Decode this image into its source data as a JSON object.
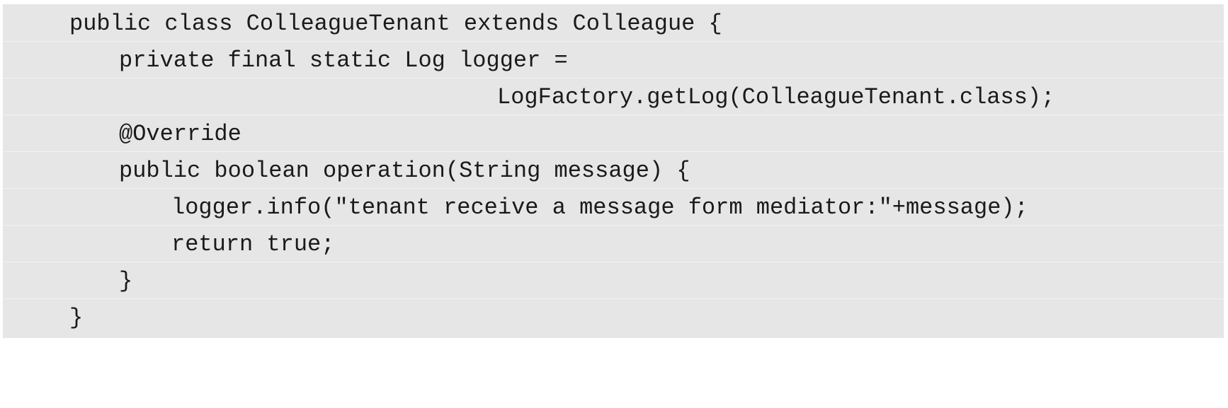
{
  "code": {
    "lines": [
      "public class ColleagueTenant extends Colleague {",
      "private final static Log logger =",
      "LogFactory.getLog(ColleagueTenant.class);",
      "@Override",
      "public boolean operation(String message) {",
      "logger.info(\"tenant receive a message form mediator:\"+message);",
      "return true;",
      "}",
      "}"
    ]
  }
}
